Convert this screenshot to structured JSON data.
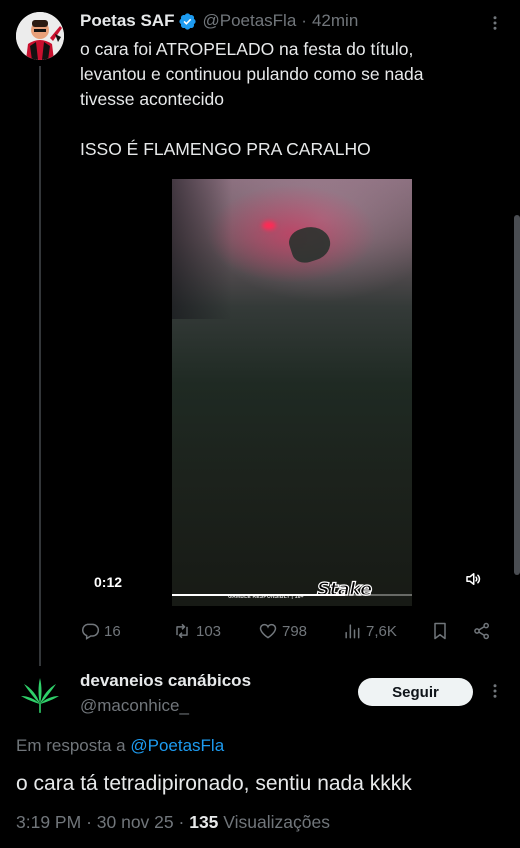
{
  "tweet": {
    "author_name": "Poetas SAF",
    "handle": "@PoetasFla",
    "time": "42min",
    "separator": "·",
    "text_lines": [
      "o cara foi ATROPELADO na festa do título,",
      "levantou e continuou pulando como se nada",
      "tivesse acontecido"
    ],
    "text_line_2": "ISSO É FLAMENGO PRA CARALHO",
    "media": {
      "elapsed": "0:12",
      "progress": 0.72,
      "sponsor": "Stake",
      "disclaimer": "GAMBLE RESPONSIBLY | 18+"
    },
    "stats": {
      "replies": "16",
      "reposts": "103",
      "likes": "798",
      "views": "7,6K"
    }
  },
  "reply": {
    "author_name": "devaneios canábicos",
    "handle": "@maconhice_",
    "follow_label": "Seguir",
    "reply_to_prefix": "Em resposta a",
    "reply_to_handle": "@PoetasFla",
    "text": "o cara tá tetradipironado, sentiu nada kkkk",
    "time": "3:19 PM",
    "date": "30 nov 25",
    "separator": "·",
    "views_count": "135",
    "views_label": "Visualizações"
  },
  "colors": {
    "background": "#000000",
    "text": "#e7e9ea",
    "muted": "#71767b",
    "accent": "#1d9bf0",
    "verified": "#1d9bf0"
  },
  "icons": [
    "verified-badge-icon",
    "more-icon",
    "volume-icon",
    "reply-icon",
    "repost-icon",
    "like-icon",
    "views-icon",
    "bookmark-icon",
    "share-icon",
    "cannabis-leaf-icon"
  ]
}
